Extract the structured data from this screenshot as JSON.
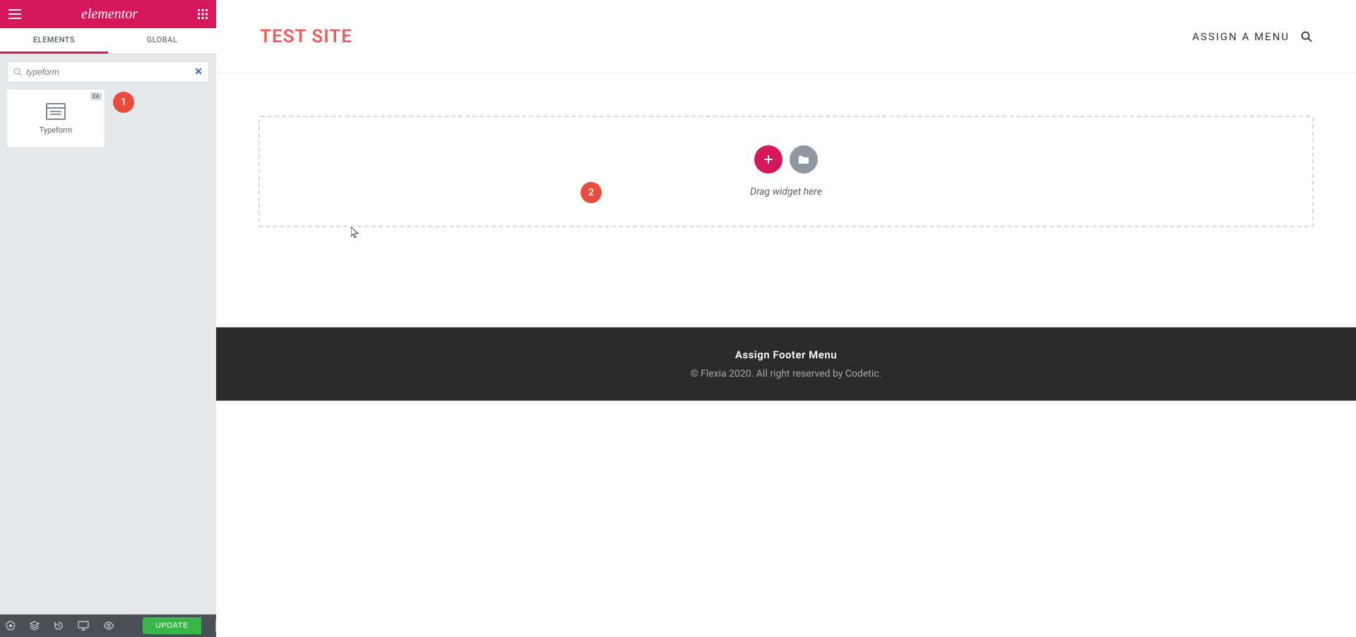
{
  "sidebar": {
    "logo": "elementor",
    "tabs": {
      "elements": "ELEMENTS",
      "global": "GLOBAL"
    },
    "search": {
      "value": "typeform"
    },
    "widgets": [
      {
        "label": "Typeform",
        "badge": "EA"
      }
    ],
    "update_label": "UPDATE"
  },
  "callouts": {
    "one": "1",
    "two": "2"
  },
  "site": {
    "title": "TEST SITE",
    "assign_menu": "ASSIGN A MENU"
  },
  "dropzone": {
    "text": "Drag widget here"
  },
  "footer": {
    "menu": "Assign Footer Menu",
    "copyright": "© Flexia 2020. All right reserved by Codetic."
  }
}
